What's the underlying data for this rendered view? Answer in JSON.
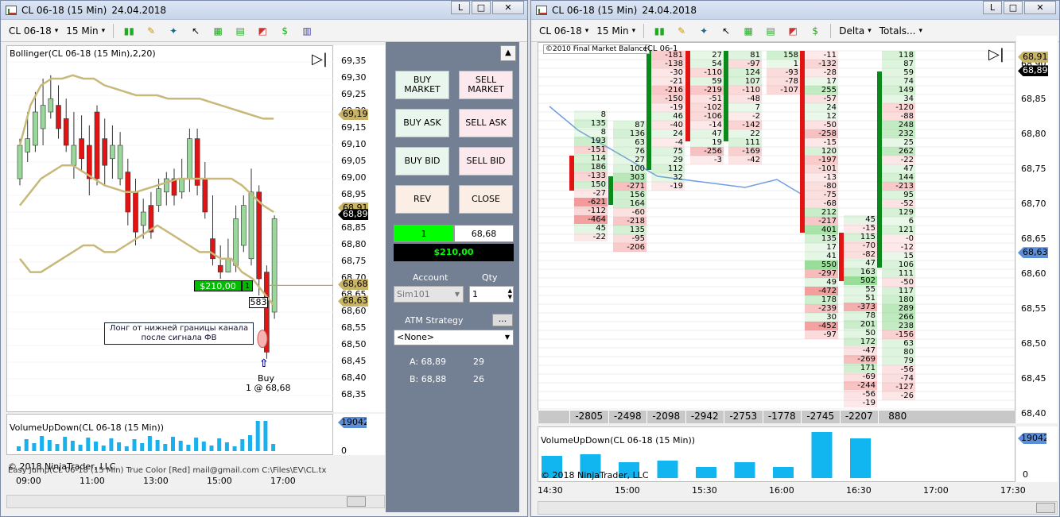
{
  "left": {
    "title": "CL 06-18 (15 Min)",
    "date": "24.04.2018",
    "win_btns": [
      "L",
      "□",
      "✕"
    ],
    "instrument": "CL 06-18",
    "interval": "15 Min",
    "indicator": "Bollinger(CL 06-18 (15 Min),2,20)",
    "price_ticks": [
      "69,35",
      "69,30",
      "69,25",
      "69,20",
      "69,15",
      "69,10",
      "69,05",
      "69,00",
      "68,95",
      "68,90",
      "68,85",
      "68,80",
      "68,75",
      "68,70",
      "68,65",
      "68,60",
      "68,55",
      "68,50",
      "68,45",
      "68,40",
      "68,35"
    ],
    "price_flags": [
      {
        "text": "69,19",
        "v": 69.19,
        "bg": "#c8b464"
      },
      {
        "text": "68,91",
        "v": 68.91,
        "bg": "#c8b464"
      },
      {
        "text": "68,89",
        "v": 68.89,
        "bg": "#000"
      },
      {
        "text": "68,68",
        "v": 68.68,
        "bg": "#c8b464"
      },
      {
        "text": "68,63",
        "v": 68.63,
        "bg": "#c8b464"
      }
    ],
    "position_pnl": "$210,00",
    "position_qty": "1",
    "order_qty": "583",
    "annotation": "Лонг от нижней границы канала после сигнала ФВ",
    "buy_label": "Buy",
    "buy_fill": "1 @ 68,68",
    "vol_title": "VolumeUpDown(CL 06-18 (15 Min))",
    "vol_flag": "19042",
    "vol_zero": "0",
    "copyright": "© 2018 NinjaTrader, LLC",
    "overlay_text": "Easy Jump(CL 06-18 (15 Min) True Color [Red] mail@gmail.com C:\\Files\\EV\\CL.tx",
    "time_ticks": [
      "09:00",
      "11:00",
      "13:00",
      "15:00",
      "17:00"
    ]
  },
  "panel": {
    "buy_market": "BUY MARKET",
    "sell_market": "SELL MARKET",
    "buy_ask": "BUY ASK",
    "sell_ask": "SELL ASK",
    "buy_bid": "BUY BID",
    "sell_bid": "SELL BID",
    "rev": "REV",
    "close": "CLOSE",
    "pos_qty": "1",
    "pos_price": "68,68",
    "pnl": "$210,00",
    "account_label": "Account",
    "qty_label": "Qty",
    "account": "Sim101",
    "qty": "1",
    "atm_label": "ATM Strategy",
    "atm_btn": "...",
    "atm_value": "<None>",
    "ask": "A: 68,89",
    "ask_size": "29",
    "bid": "B: 68,88",
    "bid_size": "26"
  },
  "right": {
    "title": "CL 06-18 (15 Min)",
    "date": "24.04.2018",
    "win_btns": [
      "L",
      "□",
      "✕"
    ],
    "instrument": "CL 06-18",
    "interval": "15 Min",
    "delta_label": "Delta",
    "totals_label": "Totals...",
    "fmb_label": "©2010 Final Market Balance",
    "indicator_frag": "(CL 06-1",
    "price_ticks": [
      "68,90",
      "68,85",
      "68,80",
      "68,75",
      "68,70",
      "68,65",
      "68,60",
      "68,55",
      "68,50",
      "68,45",
      "68,40"
    ],
    "price_flags": [
      {
        "text": "68,91",
        "v": 68.91,
        "bg": "#c8b464"
      },
      {
        "text": "68,89",
        "v": 68.89,
        "bg": "#000"
      },
      {
        "text": "68,63",
        "v": 68.63,
        "bg": "#5b8ed6"
      }
    ],
    "totals": [
      "-2805",
      "-2498",
      "-2098",
      "-2942",
      "-2753",
      "-1778",
      "-2745",
      "-2207",
      "880"
    ],
    "vol_title": "VolumeUpDown(CL 06-18 (15 Min))",
    "vol_flag": "19042",
    "vol_zero": "0",
    "copyright": "© 2018 NinjaTrader, LLC",
    "time_ticks": [
      "14:30",
      "15:00",
      "15:30",
      "16:00",
      "16:30",
      "17:00",
      "17:30"
    ],
    "fp_columns": [
      {
        "rows": [
          "8",
          "135",
          "8",
          "193",
          "-151",
          "114",
          "186",
          "-133",
          "150",
          "-27",
          "-621",
          "-112",
          "-464",
          "45",
          "-22"
        ]
      },
      {
        "rows": [
          "87",
          "136",
          "63",
          "76",
          "27",
          "100",
          "303",
          "-271",
          "156",
          "164",
          "-60",
          "-218",
          "135",
          "-95",
          "-206"
        ]
      },
      {
        "rows": [
          "-181",
          "-138",
          "-30",
          "-21",
          "-216",
          "-150",
          "-19",
          "46",
          "-40",
          "24",
          "-4",
          "75",
          "29",
          "112",
          "32",
          "-19"
        ]
      },
      {
        "rows": [
          "27",
          "54",
          "-110",
          "59",
          "-219",
          "-51",
          "-102",
          "-106",
          "-14",
          "47",
          "19",
          "-256",
          "-3"
        ]
      },
      {
        "rows": [
          "81",
          "-97",
          "124",
          "107",
          "-110",
          "-48",
          "7",
          "-2",
          "-142",
          "22",
          "111",
          "-169",
          "-42"
        ]
      },
      {
        "rows": [
          "158",
          "1",
          "-93",
          "-78",
          "-107"
        ]
      },
      {
        "rows": [
          "-11",
          "-132",
          "-28",
          "17",
          "255",
          "-57",
          "24",
          "12",
          "-50",
          "-258",
          "-15",
          "120",
          "-197",
          "-101",
          "-13",
          "-80",
          "-75",
          "-68",
          "212",
          "-217",
          "401",
          "135",
          "17",
          "41",
          "550",
          "-297",
          "49",
          "-472",
          "178",
          "-239",
          "30",
          "-452",
          "-97"
        ]
      },
      {
        "rows": [
          "45",
          "-15",
          "115",
          "-70",
          "-82",
          "47",
          "163",
          "502",
          "55",
          "51",
          "-373",
          "78",
          "201",
          "50",
          "172",
          "-47",
          "-269",
          "171",
          "-69",
          "-244",
          "-56",
          "-19"
        ]
      },
      {
        "rows": [
          "118",
          "87",
          "59",
          "74",
          "149",
          "34",
          "-120",
          "-88",
          "248",
          "232",
          "25",
          "262",
          "-22",
          "47",
          "144",
          "-213",
          "95",
          "-52",
          "129",
          "6",
          "121",
          "-0",
          "-12",
          "15",
          "106",
          "111",
          "-50",
          "117",
          "180",
          "289",
          "266",
          "238",
          "-156",
          "63",
          "80",
          "79",
          "-56",
          "-74",
          "-127",
          "-26"
        ]
      }
    ]
  }
}
